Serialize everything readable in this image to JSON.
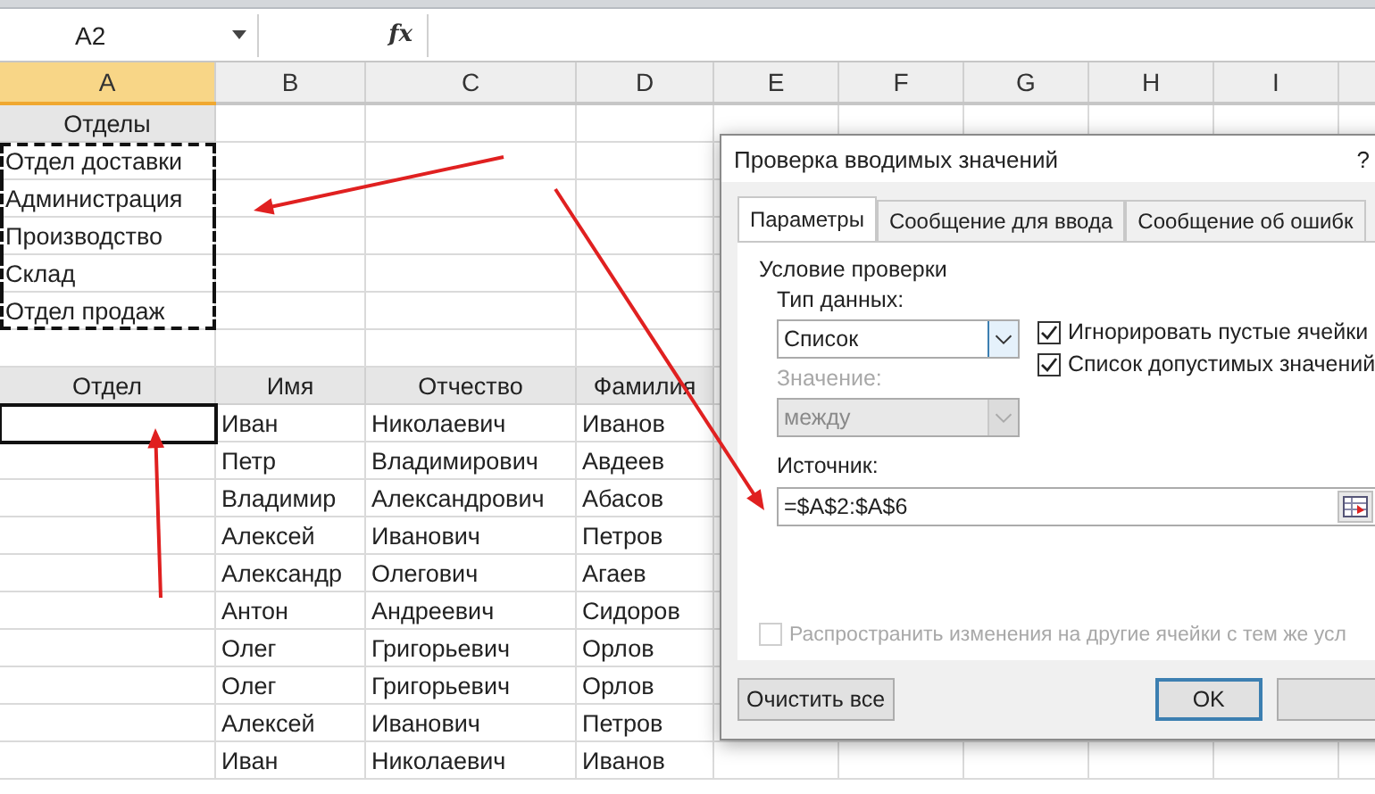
{
  "name_box": "A2",
  "formula_bar": {
    "fx": "fx"
  },
  "columns": [
    {
      "label": "A",
      "selected": true
    },
    {
      "label": "B",
      "selected": false
    },
    {
      "label": "C",
      "selected": false
    },
    {
      "label": "D",
      "selected": false
    },
    {
      "label": "E",
      "selected": false
    },
    {
      "label": "F",
      "selected": false
    },
    {
      "label": "G",
      "selected": false
    },
    {
      "label": "H",
      "selected": false
    },
    {
      "label": "I",
      "selected": false
    }
  ],
  "rows": [
    {
      "kind": "header",
      "copied": false,
      "active": false,
      "cells": [
        "Отделы"
      ]
    },
    {
      "kind": "data",
      "copied": true,
      "active": false,
      "cells": [
        "Отдел доставки"
      ]
    },
    {
      "kind": "data",
      "copied": true,
      "active": false,
      "cells": [
        "Администрация"
      ]
    },
    {
      "kind": "data",
      "copied": true,
      "active": false,
      "cells": [
        "Производство"
      ]
    },
    {
      "kind": "data",
      "copied": true,
      "active": false,
      "cells": [
        "Склад"
      ]
    },
    {
      "kind": "data",
      "copied": true,
      "active": false,
      "cells": [
        "Отдел продаж"
      ]
    },
    {
      "kind": "data",
      "copied": false,
      "active": false,
      "cells": []
    },
    {
      "kind": "header",
      "copied": false,
      "active": false,
      "cells": [
        "Отдел",
        "Имя",
        "Отчество",
        "Фамилия"
      ]
    },
    {
      "kind": "data",
      "copied": false,
      "active": true,
      "cells": [
        "",
        "Иван",
        "Николаевич",
        "Иванов"
      ]
    },
    {
      "kind": "data",
      "copied": false,
      "active": false,
      "cells": [
        "",
        "Петр",
        "Владимирович",
        "Авдеев"
      ]
    },
    {
      "kind": "data",
      "copied": false,
      "active": false,
      "cells": [
        "",
        "Владимир",
        "Александрович",
        "Абасов"
      ]
    },
    {
      "kind": "data",
      "copied": false,
      "active": false,
      "cells": [
        "",
        "Алексей",
        "Иванович",
        "Петров"
      ]
    },
    {
      "kind": "data",
      "copied": false,
      "active": false,
      "cells": [
        "",
        "Александр",
        "Олегович",
        "Агаев"
      ]
    },
    {
      "kind": "data",
      "copied": false,
      "active": false,
      "cells": [
        "",
        "Антон",
        "Андреевич",
        "Сидоров"
      ]
    },
    {
      "kind": "data",
      "copied": false,
      "active": false,
      "cells": [
        "",
        "Олег",
        "Григорьевич",
        "Орлов"
      ]
    },
    {
      "kind": "data",
      "copied": false,
      "active": false,
      "cells": [
        "",
        "Олег",
        "Григорьевич",
        "Орлов"
      ]
    },
    {
      "kind": "data",
      "copied": false,
      "active": false,
      "cells": [
        "",
        "Алексей",
        "Иванович",
        "Петров"
      ]
    },
    {
      "kind": "data",
      "copied": false,
      "active": false,
      "cells": [
        "",
        "Иван",
        "Николаевич",
        "Иванов"
      ]
    }
  ],
  "dialog": {
    "title": "Проверка вводимых значений",
    "help": "?",
    "tabs": [
      {
        "label": "Параметры",
        "selected": true
      },
      {
        "label": "Сообщение для ввода",
        "selected": false
      },
      {
        "label": "Сообщение об ошибк",
        "selected": false
      }
    ],
    "group_label": "Условие проверки",
    "data_type": {
      "label": "Тип данных:",
      "value": "Список",
      "disabled": false
    },
    "checkboxes": [
      {
        "label": "Игнорировать пустые ячейки",
        "checked": true
      },
      {
        "label": "Список допустимых значений",
        "checked": true
      }
    ],
    "value_field": {
      "label": "Значение:",
      "value": "между",
      "disabled": true
    },
    "source": {
      "label": "Источник:",
      "value": "=$A$2:$A$6"
    },
    "propagate": {
      "label": "Распространить изменения на другие ячейки с тем же усл",
      "checked": false,
      "disabled": true
    },
    "buttons": [
      {
        "label": "Очистить все",
        "default": false
      },
      {
        "label": "OK",
        "default": true
      },
      {
        "default": false
      }
    ]
  }
}
